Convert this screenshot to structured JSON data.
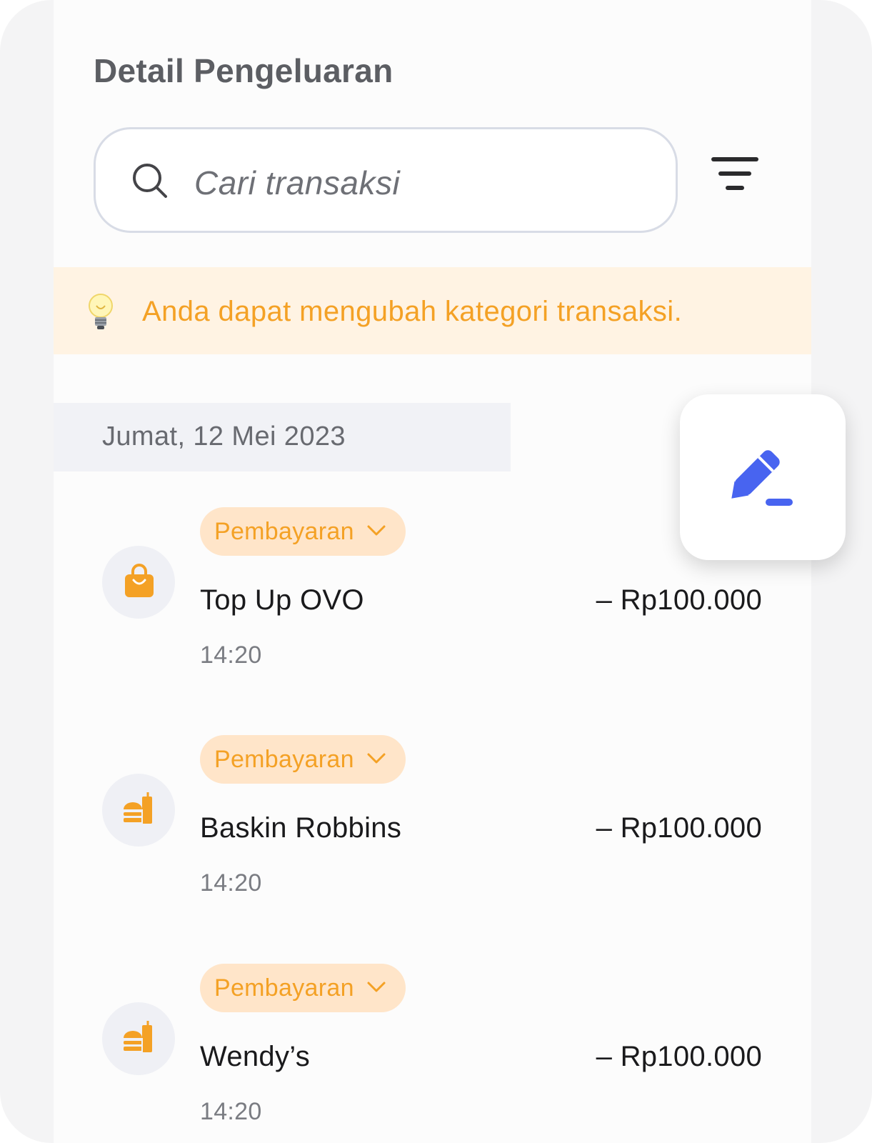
{
  "header": {
    "title": "Detail Pengeluaran"
  },
  "search": {
    "placeholder": "Cari transaksi",
    "icon": "search-icon"
  },
  "filter": {
    "icon": "filter-icon"
  },
  "tip": {
    "icon": "lightbulb-icon",
    "text": "Anda dapat mengubah kategori transaksi."
  },
  "date_group": {
    "label": "Jumat, 12 Mei 2023"
  },
  "fab": {
    "icon": "edit-pencil-icon",
    "color": "#4864f0"
  },
  "colors": {
    "accent_orange": "#f4a125",
    "chip_bg": "#ffe5c9",
    "tip_bg": "#fff3e3",
    "edit_blue": "#4864f0"
  },
  "transactions": [
    {
      "category": "Pembayaran",
      "name": "Top Up OVO",
      "amount": "– Rp100.000",
      "time": "14:20",
      "icon": "shopping-bag-icon"
    },
    {
      "category": "Pembayaran",
      "name": "Baskin Robbins",
      "amount": "– Rp100.000",
      "time": "14:20",
      "icon": "fast-food-icon"
    },
    {
      "category": "Pembayaran",
      "name": "Wendy’s",
      "amount": "– Rp100.000",
      "time": "14:20",
      "icon": "fast-food-icon"
    }
  ]
}
